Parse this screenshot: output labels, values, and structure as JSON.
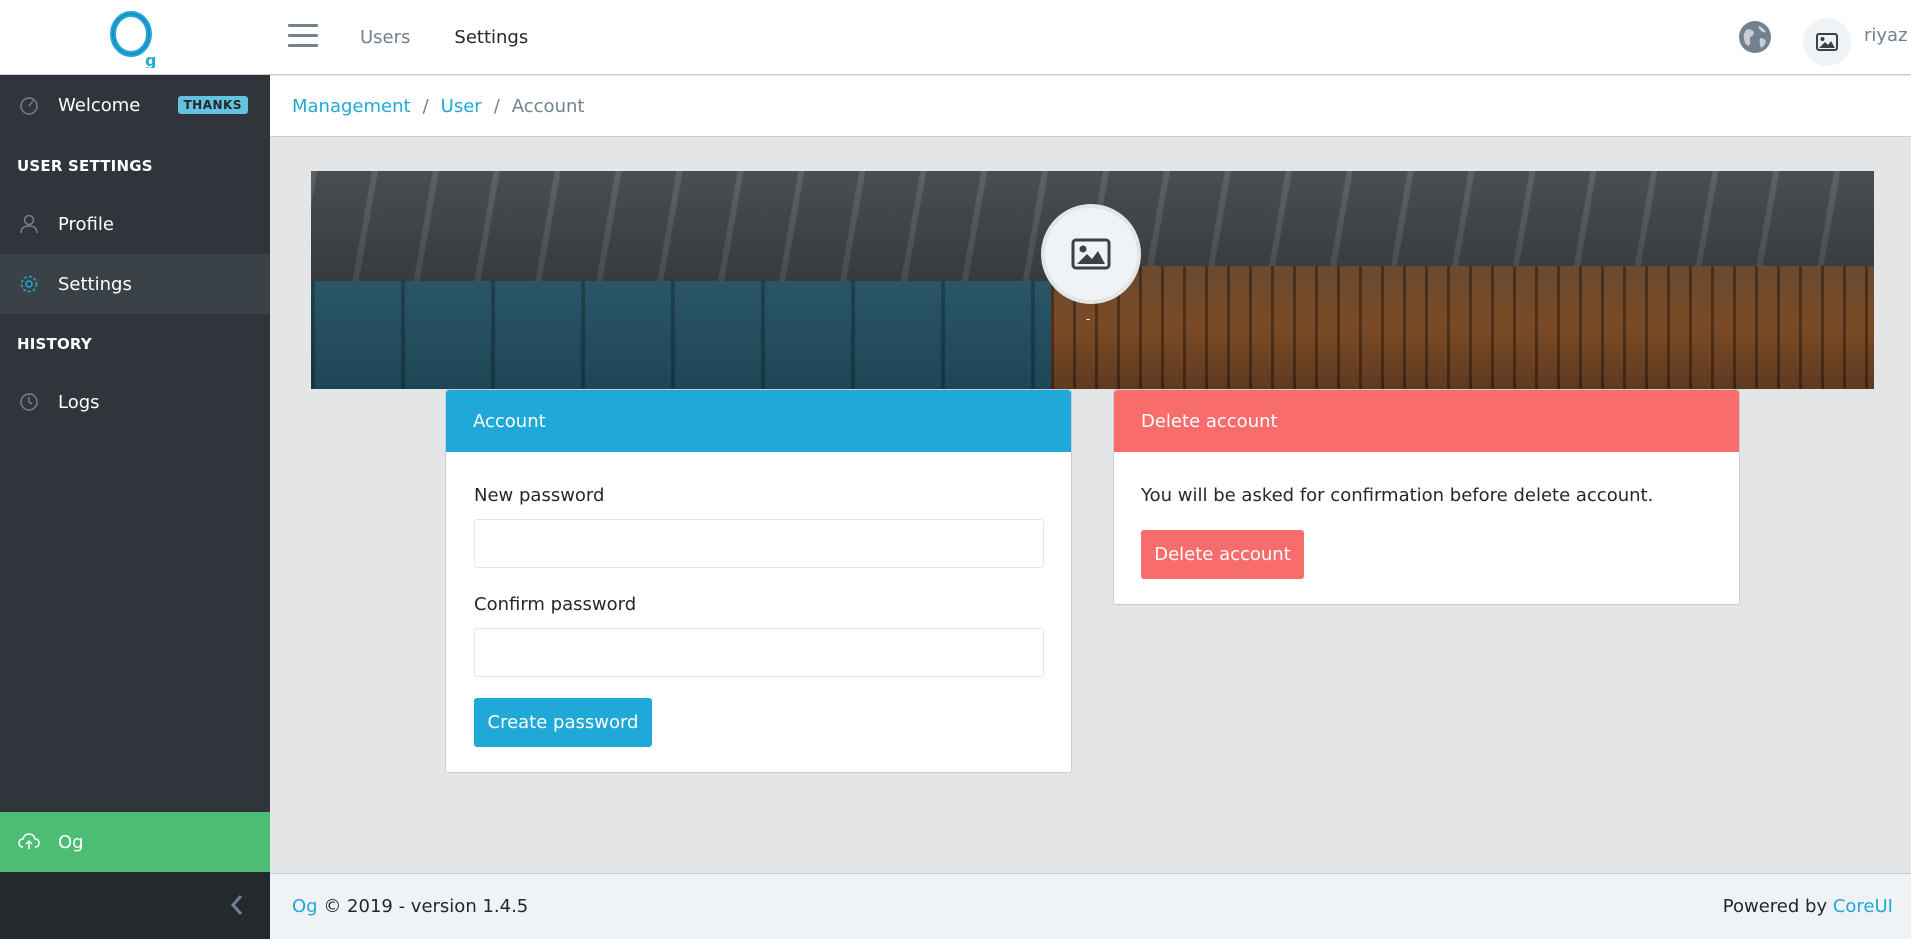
{
  "header": {
    "brand_logo": "Og",
    "nav": [
      {
        "label": "Users",
        "active": false
      },
      {
        "label": "Settings",
        "active": true
      }
    ],
    "username": "riyaz",
    "icons": {
      "menu": "hamburger-icon",
      "language": "globe-icon",
      "avatar": "image-icon"
    }
  },
  "sidebar": {
    "welcome": {
      "label": "Welcome",
      "badge": "THANKS",
      "icon": "speedometer-icon"
    },
    "section_user_settings": "USER SETTINGS",
    "profile": {
      "label": "Profile",
      "icon": "user-icon"
    },
    "settings": {
      "label": "Settings",
      "icon": "gear-icon",
      "active": true
    },
    "section_history": "HISTORY",
    "logs": {
      "label": "Logs",
      "icon": "clock-icon"
    },
    "og": {
      "label": "Og",
      "icon": "cloud-upload-icon"
    },
    "minimizer_icon": "chevron-left-icon"
  },
  "breadcrumb": {
    "items": [
      "Management",
      "User"
    ],
    "separator": "/",
    "current": "Account"
  },
  "banner": {
    "profile_caption": "-",
    "profile_icon": "image-icon"
  },
  "account_card": {
    "title": "Account",
    "new_password_label": "New password",
    "new_password_value": "",
    "confirm_password_label": "Confirm password",
    "confirm_password_value": "",
    "submit_label": "Create password"
  },
  "delete_card": {
    "title": "Delete account",
    "text": "You will be asked for confirmation before delete account.",
    "button_label": "Delete account"
  },
  "footer": {
    "brand_link": "Og",
    "copyright": "© 2019 - version 1.4.5",
    "powered_by": "Powered by",
    "powered_link": "CoreUI"
  },
  "colors": {
    "primary": "#20a8d8",
    "danger": "#f86c6b",
    "success": "#4dbd74",
    "sidebar": "#2f353a",
    "info_badge": "#63c2de"
  }
}
